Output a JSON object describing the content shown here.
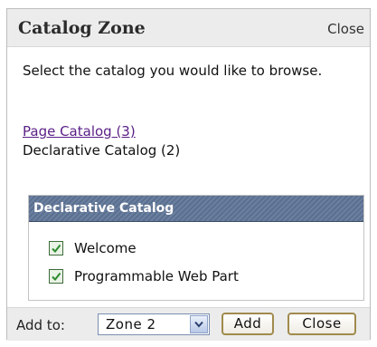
{
  "zone": {
    "title": "Catalog Zone",
    "close_label": "Close"
  },
  "instructions": "Select the catalog you would like to browse.",
  "catalogs": [
    {
      "label": "Page Catalog (3)",
      "is_link": true
    },
    {
      "label": "Declarative Catalog (2)",
      "is_link": false
    }
  ],
  "panel": {
    "header": "Declarative Catalog",
    "parts": [
      {
        "label": "Welcome",
        "checked": true
      },
      {
        "label": "Programmable Web Part",
        "checked": true
      }
    ]
  },
  "footer": {
    "add_to_label": "Add to:",
    "zone_value": "Zone 2",
    "add_button": "Add",
    "close_button": "Close"
  },
  "colors": {
    "link": "#5a1f86",
    "panel_header": "#5b6f8f",
    "checkbox_check": "#2e8b2e"
  },
  "icons": {
    "checkbox": "checkmark-icon",
    "dropdown": "chevron-down-icon"
  }
}
